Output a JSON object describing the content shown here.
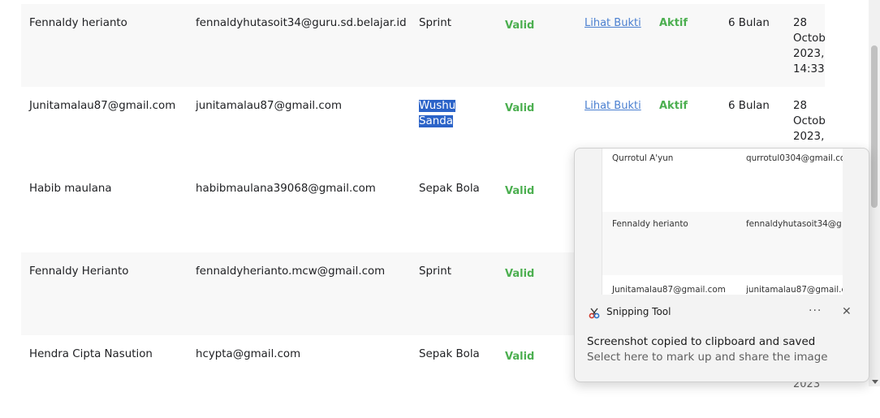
{
  "rows": [
    {
      "name": "Fennaldy herianto",
      "email": "fennaldyhutasoit34@guru.sd.belajar.id",
      "sport": "Sprint",
      "valid": "Valid",
      "proof_link": "Lihat Bukti",
      "status": "Aktif",
      "duration": "6 Bulan",
      "date": "28\nOctob\n2023,\n14:33"
    },
    {
      "name": "Junitamalau87@gmail.com",
      "email": "junitamalau87@gmail.com",
      "sport": "Wushu Sanda",
      "valid": "Valid",
      "proof_link": "Lihat Bukti",
      "status": "Aktif",
      "duration": "6 Bulan",
      "date": "28\nOctob\n2023,"
    },
    {
      "name": "Habib maulana",
      "email": "habibmaulana39068@gmail.com",
      "sport": "Sepak Bola",
      "valid": "Valid"
    },
    {
      "name": "Fennaldy Herianto",
      "email": "fennaldyherianto.mcw@gmail.com",
      "sport": "Sprint",
      "valid": "Valid"
    },
    {
      "name": "Hendra Cipta Nasution",
      "email": "hcypta@gmail.com",
      "sport": "Sepak Bola",
      "valid": "Valid"
    }
  ],
  "highlight": {
    "line1": "Wushu",
    "line2": "Sanda"
  },
  "partial_date_bottom": "2023",
  "toast": {
    "app_name": "Snipping Tool",
    "more_label": "···",
    "close_label": "✕",
    "title": "Screenshot copied to clipboard and saved",
    "subtitle": "Select here to mark up and share the image",
    "preview_rows": [
      {
        "name": "Qurrotul A'yun",
        "email": "qurrotul0304@gmail.co"
      },
      {
        "name": "Fennaldy herianto",
        "email": "fennaldyhutasoit34@g"
      },
      {
        "name": "Junitamalau87@gmail.com",
        "email": "junitamalau87@gmail.c"
      }
    ]
  },
  "colors": {
    "valid": "#4caf50",
    "link": "#4a7fd0",
    "highlight": "#2b63c8"
  },
  "icons": {
    "app": "snipping-tool-icon",
    "more": "more-icon",
    "close": "close-icon"
  }
}
